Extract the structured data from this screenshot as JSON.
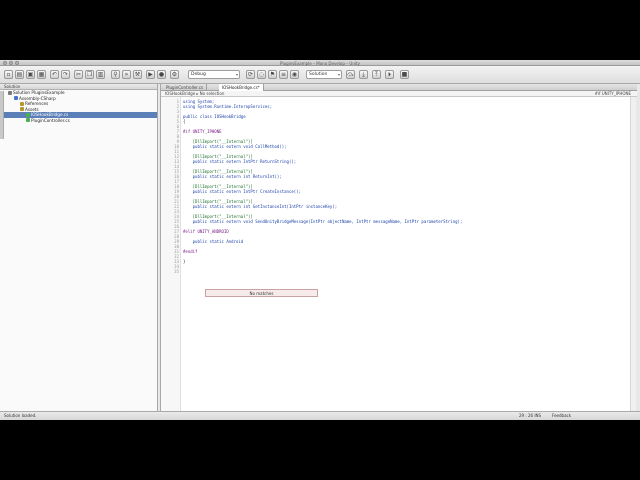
{
  "window": {
    "title": "PluginsExample – Mono Develop – Unity"
  },
  "toolbar": {
    "config_value": "Debug",
    "solution_value": "Solution"
  },
  "sidebar": {
    "header": "Solution",
    "items": [
      {
        "label": "Solution PluginsExample",
        "indent": 1,
        "selected": false,
        "color": "#7a7a7a"
      },
      {
        "label": "Assembly-CSharp",
        "indent": 2,
        "selected": false,
        "color": "#4a74c9"
      },
      {
        "label": "References",
        "indent": 3,
        "selected": false,
        "color": "#b8962e"
      },
      {
        "label": "Assets",
        "indent": 3,
        "selected": false,
        "color": "#b8962e"
      },
      {
        "label": "IOSHookBridge.cs",
        "indent": 4,
        "selected": true,
        "color": "#4caf50"
      },
      {
        "label": "PluginController.cs",
        "indent": 4,
        "selected": false,
        "color": "#4caf50"
      }
    ]
  },
  "tabs": [
    {
      "label": "PluginController.cs",
      "active": false
    },
    {
      "label": "IOSHookBridge.cs*",
      "active": true
    }
  ],
  "pathbar": {
    "left": "IOSHookBridge ▸ No selection",
    "right": "#if UNITY_IPHONE"
  },
  "code_lines": [
    {
      "n": "1",
      "t": "using System;",
      "k": "kw"
    },
    {
      "n": "2",
      "t": "using System.Runtime.InteropServices;",
      "k": "kw"
    },
    {
      "n": "3",
      "t": "",
      "k": ""
    },
    {
      "n": "4",
      "t": "public class IOSHookBridge",
      "k": "kw"
    },
    {
      "n": "5",
      "t": "{",
      "k": ""
    },
    {
      "n": "6",
      "t": "",
      "k": ""
    },
    {
      "n": "7",
      "t": "#if UNITY_IPHONE",
      "k": "pre"
    },
    {
      "n": "8",
      "t": "",
      "k": ""
    },
    {
      "n": "9",
      "t": "    [DllImport(\"__Internal\")]",
      "k": "attr"
    },
    {
      "n": "10",
      "t": "    public static extern void CallMethod();",
      "k": "kw"
    },
    {
      "n": "11",
      "t": "",
      "k": ""
    },
    {
      "n": "12",
      "t": "    [DllImport(\"__Internal\")]",
      "k": "attr"
    },
    {
      "n": "13",
      "t": "    public static extern IntPtr ReturnString();",
      "k": "kw"
    },
    {
      "n": "14",
      "t": "",
      "k": ""
    },
    {
      "n": "15",
      "t": "    [DllImport(\"__Internal\")]",
      "k": "attr"
    },
    {
      "n": "16",
      "t": "    public static extern int ReturnInt();",
      "k": "kw"
    },
    {
      "n": "17",
      "t": "",
      "k": ""
    },
    {
      "n": "18",
      "t": "    [DllImport(\"__Internal\")]",
      "k": "attr"
    },
    {
      "n": "19",
      "t": "    public static extern IntPtr CreateInstance();",
      "k": "kw"
    },
    {
      "n": "20",
      "t": "",
      "k": ""
    },
    {
      "n": "21",
      "t": "    [DllImport(\"__Internal\")]",
      "k": "attr"
    },
    {
      "n": "22",
      "t": "    public static extern int GetInstanceInt(IntPtr instanceKey);",
      "k": "kw"
    },
    {
      "n": "23",
      "t": "",
      "k": ""
    },
    {
      "n": "24",
      "t": "    [DllImport(\"__Internal\")]",
      "k": "attr"
    },
    {
      "n": "25",
      "t": "    public static extern void SendUnityBridgeMessage(IntPtr objectName, IntPtr messageName, IntPtr parameterString);",
      "k": "kw"
    },
    {
      "n": "26",
      "t": "",
      "k": ""
    },
    {
      "n": "27",
      "t": "#elif UNITY_ANDROID",
      "k": "pre"
    },
    {
      "n": "28",
      "t": "",
      "k": ""
    },
    {
      "n": "29",
      "t": "    public static Android",
      "k": "kw"
    },
    {
      "n": "30",
      "t": "",
      "k": ""
    },
    {
      "n": "31",
      "t": "#endif",
      "k": "pre"
    },
    {
      "n": "32",
      "t": "",
      "k": ""
    },
    {
      "n": "33",
      "t": "}",
      "k": ""
    },
    {
      "n": "34",
      "t": "",
      "k": ""
    },
    {
      "n": "35",
      "t": "",
      "k": ""
    }
  ],
  "popup": {
    "text": "No matches"
  },
  "status": {
    "left": "Solution loaded.",
    "position": "29 : 26   INS",
    "feedback": "Feedback"
  }
}
